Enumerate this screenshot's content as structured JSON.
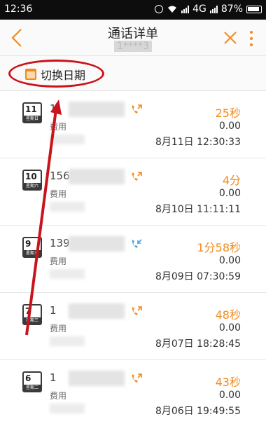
{
  "status_bar": {
    "time": "12:36",
    "network": "4G",
    "battery": "87%"
  },
  "header": {
    "title": "通话详单",
    "subtitle": "1****3"
  },
  "date_switch": {
    "label": "切换日期"
  },
  "records": [
    {
      "day": "11",
      "weekday": "星期日",
      "number": "1",
      "fee_label": "费用",
      "duration": "25秒",
      "fee": "0.00",
      "datetime": "8月11日  12:30:33",
      "direction": "outgoing"
    },
    {
      "day": "10",
      "weekday": "星期六",
      "number": "1565",
      "fee_label": "费用",
      "duration": "4分",
      "fee": "0.00",
      "datetime": "8月10日  11:11:11",
      "direction": "outgoing"
    },
    {
      "day": "9",
      "weekday": "星期五",
      "number": "139",
      "fee_label": "费用",
      "duration": "1分58秒",
      "fee": "0.00",
      "datetime": "8月09日  07:30:59",
      "direction": "incoming"
    },
    {
      "day": "7",
      "weekday": "星期三",
      "number": "1",
      "fee_label": "费用",
      "duration": "48秒",
      "fee": "0.00",
      "datetime": "8月07日  18:28:45",
      "direction": "outgoing"
    },
    {
      "day": "6",
      "weekday": "星期二",
      "number": "1",
      "fee_label": "费用",
      "duration": "43秒",
      "fee": "0.00",
      "datetime": "8月06日  19:49:55",
      "direction": "outgoing"
    }
  ],
  "colors": {
    "accent": "#f28a1c",
    "annotation": "#c8141a",
    "incoming": "#4aa3df"
  }
}
